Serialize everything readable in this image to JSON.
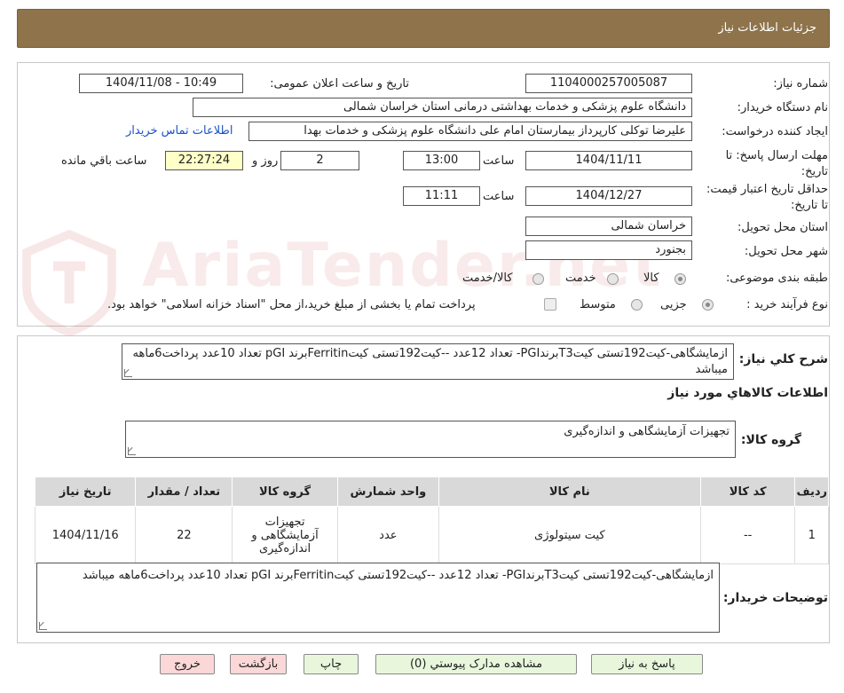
{
  "header": {
    "title": "جزئیات اطلاعات نیاز"
  },
  "labels": {
    "need_number": "شماره نیاز:",
    "announce_datetime": "تاریخ و ساعت اعلان عمومی:",
    "buyer_org": "نام دستگاه خریدار:",
    "requester": "ایجاد کننده درخواست:",
    "reply_deadline": "مهلت ارسال پاسخ: تا تاریخ:",
    "time": "ساعت",
    "days_and": "روز و",
    "hours_remaining": "ساعت باقي مانده",
    "price_validity": "حداقل تاریخ اعتبار قیمت: تا تاریخ:",
    "delivery_province": "استان محل تحویل:",
    "delivery_city": "شهر محل تحویل:",
    "category": "طبقه بندی موضوعی:",
    "purchase_process": "نوع فرآیند خرید :",
    "general_description": "شرح کلي نياز:",
    "goods_info": "اطلاعات کالاهاي مورد نياز",
    "goods_group": "گروه کالا:",
    "buyer_notes": "توضیحات خریدار:"
  },
  "fields": {
    "need_number": "1104000257005087",
    "announce_datetime": "1404/11/08 - 10:49",
    "buyer_org": "دانشگاه علوم پزشکی و خدمات بهداشتی درمانی استان خراسان شمالی",
    "requester": "علیرضا توکلی کارپرداز بیمارستان امام علی دانشگاه علوم پزشکی و خدمات بهدا",
    "contact_link": "اطلاعات تماس خریدار",
    "reply_date": "1404/11/11",
    "reply_time": "13:00",
    "days": "2",
    "countdown": "22:27:24",
    "validity_date": "1404/12/27",
    "validity_time": "11:11",
    "province": "خراسان شمالی",
    "city": "بجنورد"
  },
  "category_options": [
    {
      "label": "کالا",
      "selected": true
    },
    {
      "label": "خدمت",
      "selected": false
    },
    {
      "label": "کالا/خدمت",
      "selected": false
    }
  ],
  "process_options": [
    {
      "label": "جزیی",
      "selected": true
    },
    {
      "label": "متوسط",
      "selected": false
    }
  ],
  "payment_note": "پرداخت تمام یا بخشی از مبلغ خرید،از محل \"اسناد خزانه اسلامی\" خواهد بود.",
  "general_description": "ازمایشگاهی-کیت192تستی کیتT3برندPGI- تعداد 12عدد     --کیت192تستی کیتFerritinبرند pGI   تعداد 10عدد پرداخت6ماهه میباشد",
  "goods_group": "تجهیزات آزمایشگاهی و اندازه‌گیری",
  "table": {
    "headers": [
      "ردیف",
      "کد کالا",
      "نام کالا",
      "واحد شمارش",
      "گروه کالا",
      "تعداد / مقدار",
      "تاریخ نیاز"
    ],
    "rows": [
      [
        "1",
        "--",
        "کیت سیتولوژی",
        "عدد",
        "تجهیزات آزمایشگاهی و اندازه‌گیری",
        "22",
        "1404/11/16"
      ]
    ]
  },
  "buyer_notes": "ازمایشگاهی-کیت192تستی کیتT3برندPGI- تعداد 12عدد     --کیت192تستی کیتFerritinبرند pGI   تعداد  10عدد پرداخت6ماهه میباشد",
  "buttons": {
    "reply": "پاسخ به نیاز",
    "attachments": "مشاهده مدارک پیوستي (0)",
    "print": "چاپ",
    "back": "بازگشت",
    "exit": "خروج"
  },
  "watermark": "AriaTender.net",
  "colors": {
    "header": "#8e734b",
    "link": "#1a53c7",
    "countdown_bg": "#ffffc8",
    "btn_green": "#e8f7dc",
    "btn_red": "#fbd7d7"
  }
}
